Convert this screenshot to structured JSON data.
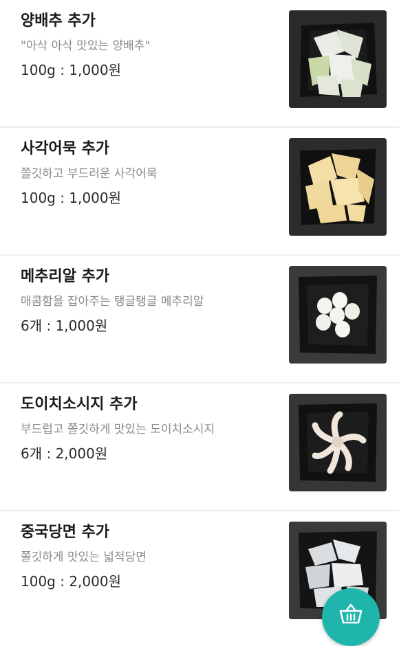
{
  "items": [
    {
      "name": "양배추 추가",
      "description": "\"아삭 아삭 맛있는 양배추\"",
      "price": "100g : 1,000원",
      "image": "cabbage-image"
    },
    {
      "name": "사각어묵 추가",
      "description": "쫄깃하고 부드러운 사각어묵",
      "price": "100g : 1,000원",
      "image": "fishcake-image"
    },
    {
      "name": "메추리알 추가",
      "description": "매콤함을 잡아주는 탱글탱글 메추리알",
      "price": "6개 : 1,000원",
      "image": "quail-egg-image"
    },
    {
      "name": "도이치소시지 추가",
      "description": "부드럽고 쫄깃하게 맛있는 도이치소시지",
      "price": "6개 : 2,000원",
      "image": "sausage-image"
    },
    {
      "name": "중국당면 추가",
      "description": "쫄깃하게 맛있는 넓적당면",
      "price": "100g : 2,000원",
      "image": "glass-noodle-image"
    }
  ],
  "cart_button": {
    "icon": "basket-icon"
  },
  "colors": {
    "accent": "#1fb5ad",
    "divider": "#eeeeee",
    "description": "#8a8a8a"
  }
}
